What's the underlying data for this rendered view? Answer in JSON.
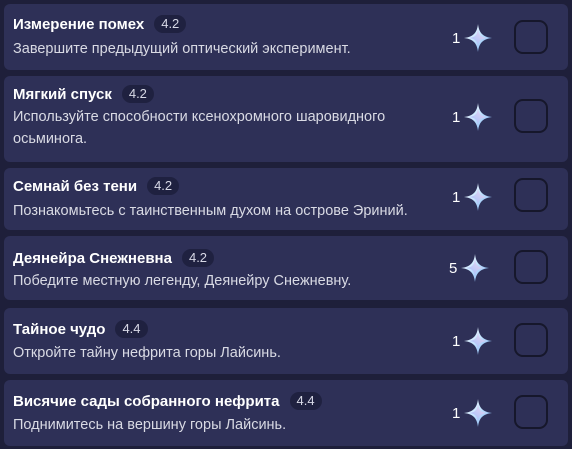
{
  "achievements": [
    {
      "title": "Измерение помех",
      "version": "4.2",
      "description": "Завершите предыдущий оптический эксперимент.",
      "reward_count": "1",
      "reward_icon": "primogem-icon",
      "completed": false
    },
    {
      "title": "Мягкий спуск",
      "version": "4.2",
      "description": "Используйте способности ксенохромного шаровидного осьминога.",
      "reward_count": "1",
      "reward_icon": "primogem-icon",
      "completed": false
    },
    {
      "title": "Семнай без тени",
      "version": "4.2",
      "description": "Познакомьтесь с таинственным духом на острове Эриний.",
      "reward_count": "1",
      "reward_icon": "primogem-icon",
      "completed": false
    },
    {
      "title": "Деянейра Снежневна",
      "version": "4.2",
      "description": "Победите местную легенду, Деянейру Снежневну.",
      "reward_count": "5",
      "reward_icon": "primogem-icon",
      "completed": false
    },
    {
      "title": "Тайное чудо",
      "version": "4.4",
      "description": "Откройте тайну нефрита горы Лайсинь.",
      "reward_count": "1",
      "reward_icon": "primogem-icon",
      "completed": false
    },
    {
      "title": "Висячие сады собранного нефрита",
      "version": "4.4",
      "description": "Поднимитесь на вершину горы Лайсинь.",
      "reward_count": "1",
      "reward_icon": "primogem-icon",
      "completed": false
    }
  ],
  "colors": {
    "background": "#1e1f3a",
    "card": "#2e3057",
    "badge": "#1f2140",
    "checkbox_border": "#16172b"
  }
}
